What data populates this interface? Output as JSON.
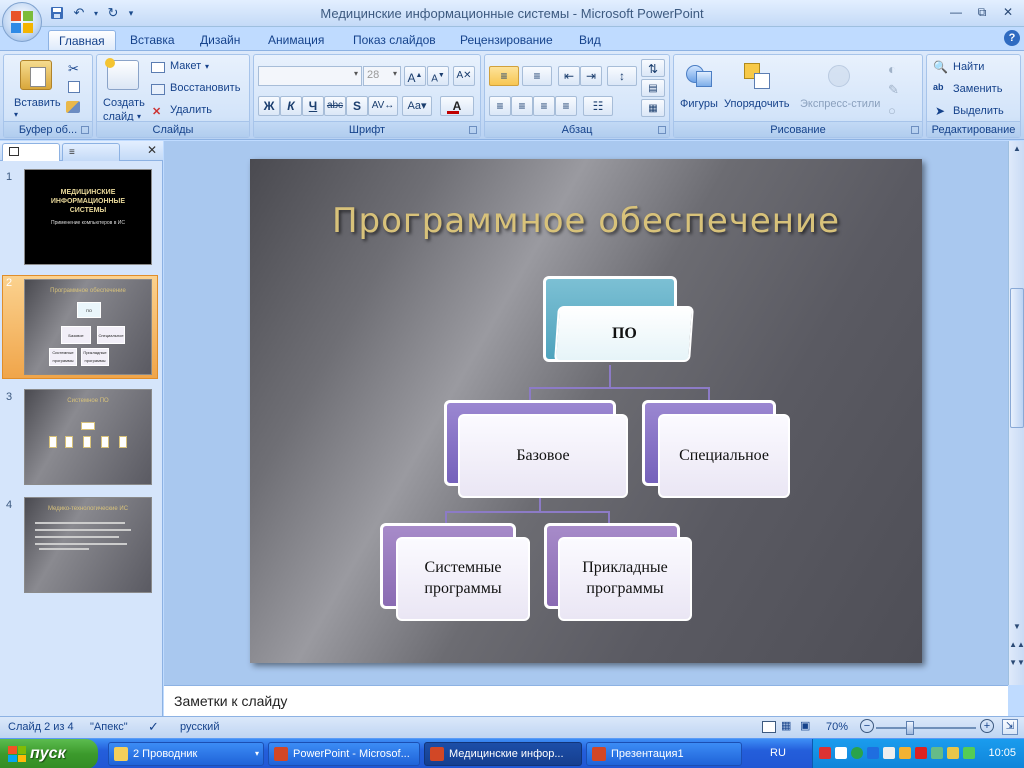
{
  "window": {
    "title": "Медицинские информационные системы - Microsoft PowerPoint"
  },
  "tabs": [
    {
      "label": "Главная"
    },
    {
      "label": "Вставка"
    },
    {
      "label": "Дизайн"
    },
    {
      "label": "Анимация"
    },
    {
      "label": "Показ слайдов"
    },
    {
      "label": "Рецензирование"
    },
    {
      "label": "Вид"
    }
  ],
  "ribbon": {
    "clipboard": {
      "label": "Буфер об...",
      "paste": "Вставить"
    },
    "slides": {
      "label": "Слайды",
      "new_slide_line1": "Создать",
      "new_slide_line2": "слайд",
      "layout": "Макет",
      "reset": "Восстановить",
      "delete": "Удалить"
    },
    "font": {
      "label": "Шрифт",
      "font_name": "",
      "font_size": "28"
    },
    "paragraph": {
      "label": "Абзац"
    },
    "drawing": {
      "label": "Рисование",
      "shapes": "Фигуры",
      "arrange": "Упорядочить",
      "quick_styles": "Экспресс-стили"
    },
    "editing": {
      "label": "Редактирование",
      "find": "Найти",
      "replace": "Заменить",
      "select": "Выделить"
    }
  },
  "thumbnails": [
    {
      "num": "1",
      "title": "МЕДИЦИНСКИЕ ИНФОРМАЦИОННЫЕ СИСТЕМЫ",
      "subtitle": "Применение компьютеров в ИС"
    },
    {
      "num": "2",
      "title": "Программное обеспечение",
      "nodes": [
        "ПО",
        "Базовое",
        "Специальное",
        "Системные программы",
        "Прикладные программы"
      ]
    },
    {
      "num": "3",
      "title": "Системное ПО"
    },
    {
      "num": "4",
      "title": "Медико-технологические ИС"
    }
  ],
  "slide": {
    "title": "Программное обеспечение",
    "root": "ПО",
    "level1": [
      "Базовое",
      "Специальное"
    ],
    "level2": [
      "Системные программы",
      "Прикладные программы"
    ]
  },
  "notes": {
    "placeholder": "Заметки к слайду"
  },
  "status": {
    "slide_info": "Слайд 2 из 4",
    "theme": "\"Апекс\"",
    "language": "русский",
    "zoom": "70%"
  },
  "taskbar": {
    "start": "пуск",
    "tasks": [
      "2 Проводник",
      "PowerPoint - Microsof...",
      "Медицинские инфор...",
      "Презентация1"
    ],
    "lang": "RU",
    "clock": "10:05"
  },
  "colors": {
    "accent": "#2f6bc1",
    "ribbon": "#bfdbff",
    "taskbar": "#245edb",
    "start": "#3c9a2c",
    "slide_title": "#d8c27a",
    "smartart": "#8c7bc6"
  }
}
